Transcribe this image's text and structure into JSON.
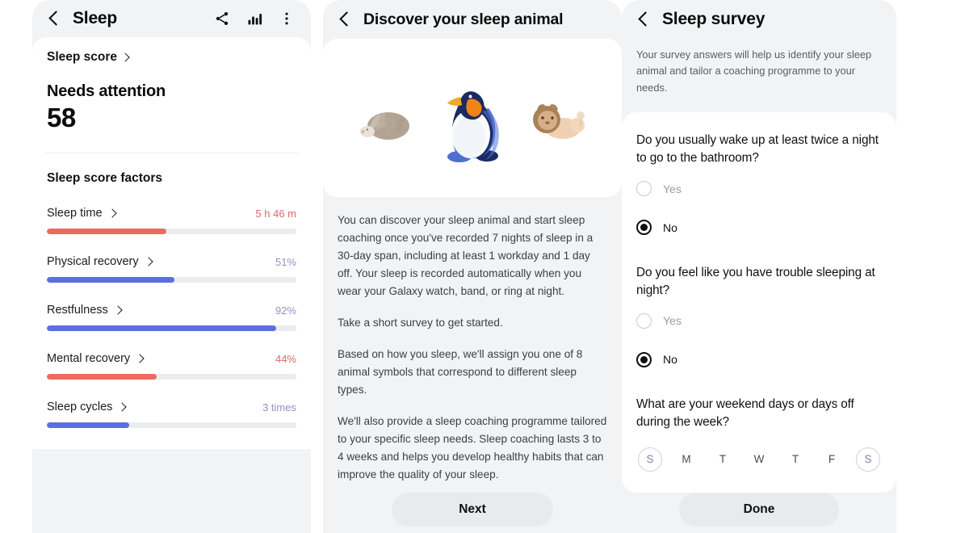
{
  "panel1": {
    "appbar": {
      "title": "Sleep",
      "back_icon": "back-arrow-icon",
      "share_icon": "share-icon",
      "chart_icon": "bar-chart-icon",
      "more_icon": "more-vertical-icon"
    },
    "sleep_score_link": "Sleep score",
    "status": "Needs attention",
    "score": "58",
    "factors_title": "Sleep score factors",
    "factors": [
      {
        "name": "Sleep time",
        "value": "5 h 46 m",
        "percent": 48,
        "color": "red"
      },
      {
        "name": "Physical recovery",
        "value": "51%",
        "percent": 51,
        "color": "blue"
      },
      {
        "name": "Restfulness",
        "value": "92%",
        "percent": 92,
        "color": "blue"
      },
      {
        "name": "Mental recovery",
        "value": "44%",
        "percent": 44,
        "color": "red"
      },
      {
        "name": "Sleep cycles",
        "value": "3 times",
        "percent": 33,
        "color": "blue"
      }
    ]
  },
  "panel2": {
    "appbar": {
      "title": "Discover your sleep animal",
      "back_icon": "back-arrow-icon"
    },
    "animals": [
      "hedgehog-illustration",
      "penguin-illustration",
      "lion-illustration"
    ],
    "paragraphs": [
      "You can discover your sleep animal and start sleep coaching once you've recorded 7 nights of sleep in a 30-day span, including at least 1 workday and 1 day off. Your sleep is recorded automatically when you wear your Galaxy watch, band, or ring at night.",
      "Take a short survey to get started.",
      "Based on how you sleep, we'll assign you one of 8 animal symbols that correspond to different sleep types.",
      "We'll also provide a sleep coaching programme tailored to your specific sleep needs. Sleep coaching lasts 3 to 4 weeks and helps you develop healthy habits that can improve the quality of your sleep."
    ],
    "next_button": "Next"
  },
  "panel3": {
    "appbar": {
      "title": "Sleep survey",
      "back_icon": "back-arrow-icon"
    },
    "intro": "Your survey answers will help us identify your sleep animal and tailor a coaching programme to your needs.",
    "questions": [
      {
        "text": "Do you usually wake up at least twice a night to go to the bathroom?",
        "options": [
          {
            "label": "Yes",
            "selected": false
          },
          {
            "label": "No",
            "selected": true
          }
        ]
      },
      {
        "text": "Do you feel like you have trouble sleeping at night?",
        "options": [
          {
            "label": "Yes",
            "selected": false
          },
          {
            "label": "No",
            "selected": true
          }
        ]
      }
    ],
    "days_question": "What are your weekend days or days off during the week?",
    "days": [
      {
        "label": "S",
        "selected": true
      },
      {
        "label": "M",
        "selected": false
      },
      {
        "label": "T",
        "selected": false
      },
      {
        "label": "W",
        "selected": false
      },
      {
        "label": "T",
        "selected": false
      },
      {
        "label": "F",
        "selected": false
      },
      {
        "label": "S",
        "selected": true
      }
    ],
    "done_button": "Done"
  },
  "colors": {
    "red": "#ec6a62",
    "blue": "#5b6fe0",
    "red_text": "#d96a6a",
    "blue_text": "#8f93c4",
    "panel_bg": "#f2f3f5",
    "card_bg": "#ffffff",
    "button_bg": "#e9eaec"
  }
}
